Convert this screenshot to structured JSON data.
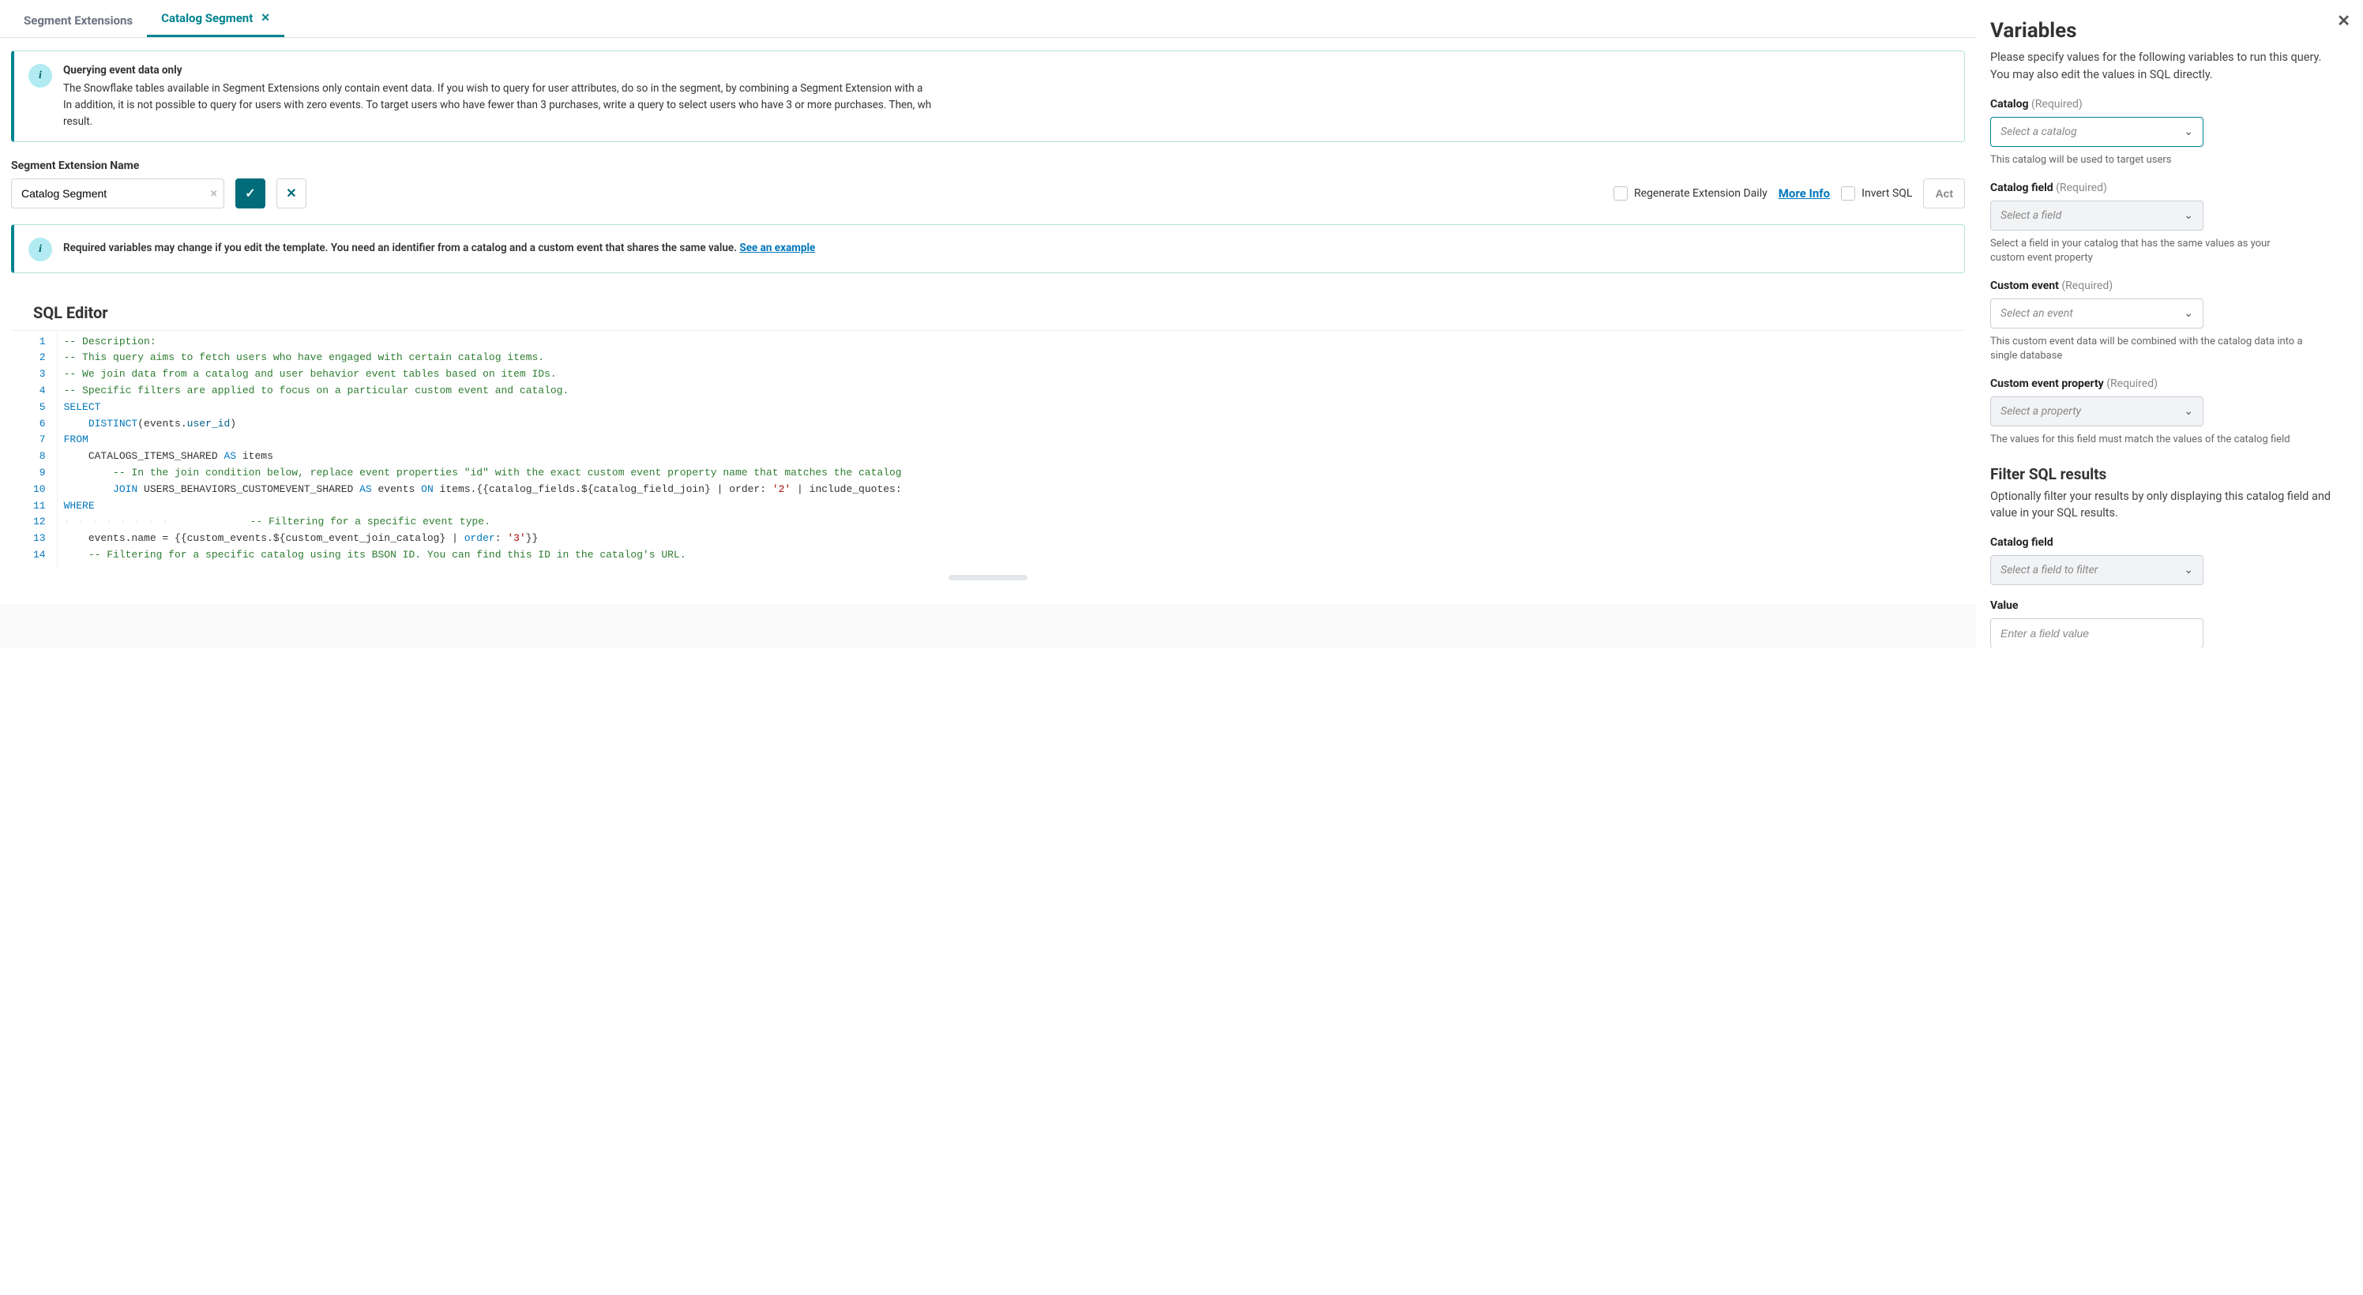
{
  "tabs": {
    "t0": "Segment Extensions",
    "t1": "Catalog Segment"
  },
  "notice1": {
    "title": "Querying event data only",
    "line1": "The Snowflake tables available in Segment Extensions only contain event data. If you wish to query for user attributes, do so in the segment, by combining a Segment Extension with a",
    "line2": "In addition, it is not possible to query for users with zero events. To target users who have fewer than 3 purchases, write a query to select users who have 3 or more purchases. Then, wh",
    "line3": "result."
  },
  "form": {
    "name_label": "Segment Extension Name",
    "name_value": "Catalog Segment",
    "regen_label": "Regenerate Extension Daily",
    "more_info": "More Info",
    "invert_label": "Invert SQL",
    "actions": "Act"
  },
  "notice2": {
    "text": "Required variables may change if you edit the template. You need an identifier from a catalog and a custom event that shares the same value. ",
    "link": "See an example"
  },
  "editor": {
    "title": "SQL Editor"
  },
  "sql": {
    "l1": "-- Description:",
    "l2": "-- This query aims to fetch users who have engaged with certain catalog items.",
    "l3": "-- We join data from a catalog and user behavior event tables based on item IDs.",
    "l4": "-- Specific filters are applied to focus on a particular custom event and catalog.",
    "l5_kw": "SELECT",
    "l6_kw": "DISTINCT",
    "l6_rest": "(events.",
    "l6_id": "user_id",
    "l6_close": ")",
    "l7_kw": "FROM",
    "l8": "    CATALOGS_ITEMS_SHARED ",
    "l8_as": "AS",
    "l8_tbl": " items",
    "l9": "        -- In the join condition below, replace event properties \"id\" with the exact custom event property name that matches the catalog",
    "l10_join": "JOIN",
    "l10_t": " USERS_BEHAVIORS_CUSTOMEVENT_SHARED ",
    "l10_as": "AS",
    "l10_ev": " events ",
    "l10_on": "ON",
    "l10_rest": " items.{{catalog_fields.${catalog_field_join} | order: ",
    "l10_n": "'2'",
    "l10_rest2": " | include_quotes:",
    "l11_kw": "WHERE",
    "l12": "            -- Filtering for a specific event type.",
    "l13a": "    events.name = {{custom_events.${custom_event_join_catalog} | ",
    "l13_kw": "order",
    "l13b": ": ",
    "l13_n": "'3'",
    "l13c": "}}",
    "l14": "    -- Filtering for a specific catalog using its BSON ID. You can find this ID in the catalog's URL."
  },
  "panel": {
    "title": "Variables",
    "desc": "Please specify values for the following variables to run this query. You may also edit the values in SQL directly.",
    "catalog_label": "Catalog",
    "req": "(Required)",
    "catalog_placeholder": "Select a catalog",
    "catalog_hint": "This catalog will be used to target users",
    "catalog_field_label": "Catalog field",
    "catalog_field_placeholder": "Select a field",
    "catalog_field_hint": "Select a field in your catalog that has the same values as your custom event property",
    "custom_event_label": "Custom event",
    "custom_event_placeholder": "Select an event",
    "custom_event_hint": "This custom event data will be combined with the catalog data into a single database",
    "cep_label": "Custom event property",
    "cep_placeholder": "Select a property",
    "cep_hint": "The values for this field must match the values of the catalog field",
    "filter_title": "Filter SQL results",
    "filter_desc": "Optionally filter your results by only displaying this catalog field and value in your SQL results.",
    "filter_field_label": "Catalog field",
    "filter_field_placeholder": "Select a field to filter",
    "value_label": "Value",
    "value_placeholder": "Enter a field value"
  }
}
